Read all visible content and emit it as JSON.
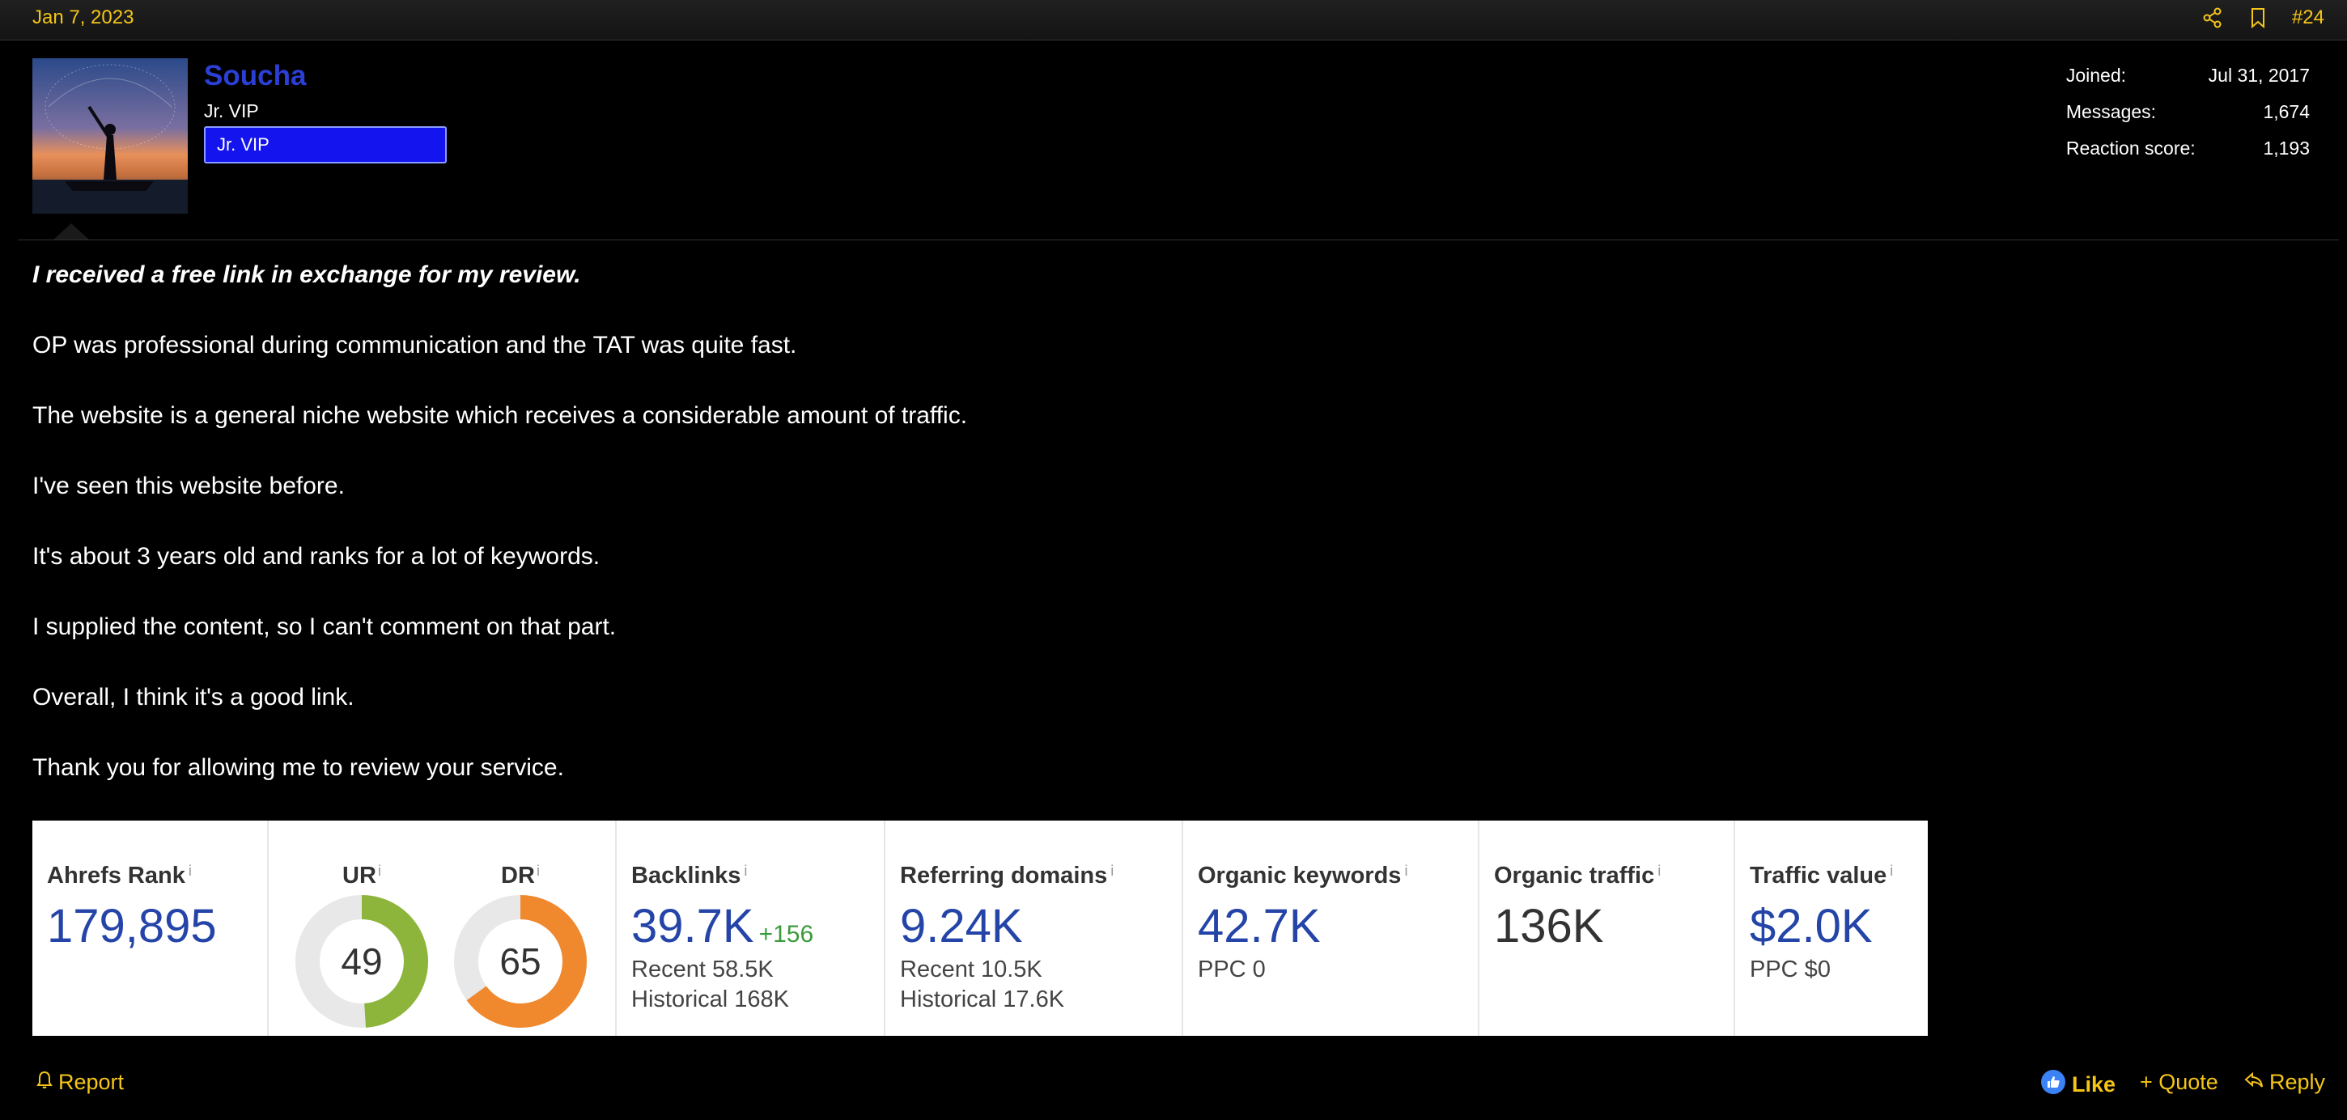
{
  "post": {
    "date": "Jan 7, 2023",
    "number": "#24"
  },
  "author": {
    "username": "Soucha",
    "title": "Jr. VIP",
    "banner": "Jr. VIP",
    "stats": [
      {
        "label": "Joined:",
        "value": "Jul 31, 2017"
      },
      {
        "label": "Messages:",
        "value": "1,674"
      },
      {
        "label": "Reaction score:",
        "value": "1,193"
      }
    ]
  },
  "body": {
    "paragraphs": [
      "I received a free link in exchange for my review.",
      "OP was professional during communication and the TAT was quite fast.",
      "The website is a general niche website which receives a considerable amount of traffic.",
      "I've seen this website before.",
      "It's about 3 years old and ranks for a lot of keywords.",
      "I supplied the content, so I can't comment on that part.",
      "Overall, I think it's a good link.",
      "Thank you for allowing me to review your service."
    ]
  },
  "ahrefs": {
    "info_mark": "i",
    "rank": {
      "label": "Ahrefs Rank",
      "value": "179,895"
    },
    "ur": {
      "label": "UR",
      "value": 49,
      "color": "#8db53c"
    },
    "dr": {
      "label": "DR",
      "value": 65,
      "color": "#f0882e"
    },
    "backlinks": {
      "label": "Backlinks",
      "value": "39.7K",
      "change": "+156",
      "recent": "Recent 58.5K",
      "historical": "Historical 168K"
    },
    "referring_domains": {
      "label": "Referring domains",
      "value": "9.24K",
      "recent": "Recent 10.5K",
      "historical": "Historical 17.6K"
    },
    "organic_keywords": {
      "label": "Organic keywords",
      "value": "42.7K",
      "ppc": "PPC 0"
    },
    "organic_traffic": {
      "label": "Organic traffic",
      "value": "136K"
    },
    "traffic_value": {
      "label": "Traffic value",
      "value": "$2.0K",
      "ppc": "PPC $0"
    }
  },
  "actions": {
    "report": "Report",
    "like": "Like",
    "quote": "+ Quote",
    "reply": "Reply"
  },
  "colors": {
    "accent": "#f5c518",
    "username": "#2b3fd6",
    "banner": "#1414ee",
    "ahrefs_blue": "#2444a8"
  },
  "icons": [
    "share-icon",
    "bookmark-icon",
    "bell-icon",
    "thumbs-up-icon",
    "reply-arrow-icon"
  ]
}
